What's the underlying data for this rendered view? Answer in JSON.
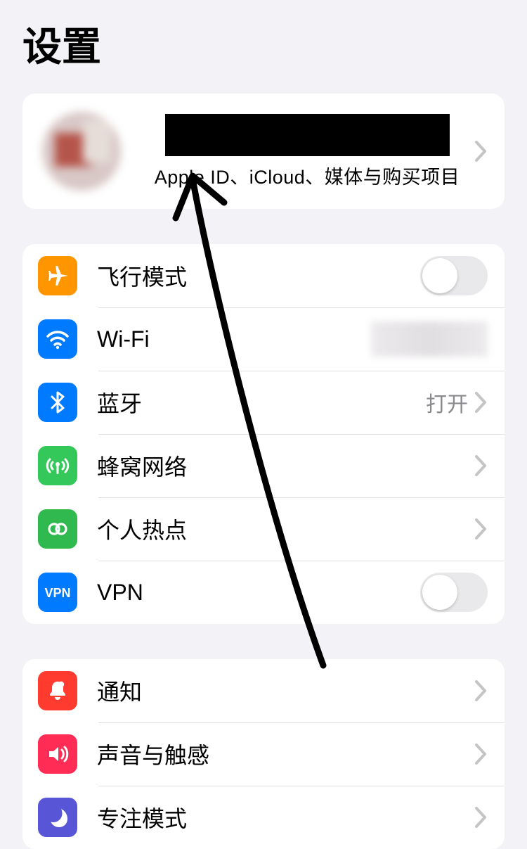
{
  "title": "设置",
  "account": {
    "subtitle": "Apple ID、iCloud、媒体与购买项目"
  },
  "groups": [
    {
      "rows": [
        {
          "key": "airplane",
          "label": "飞行模式",
          "control": "toggle",
          "on": false
        },
        {
          "key": "wifi",
          "label": "Wi-Fi",
          "control": "blur"
        },
        {
          "key": "bluetooth",
          "label": "蓝牙",
          "control": "link",
          "value": "打开"
        },
        {
          "key": "cellular",
          "label": "蜂窝网络",
          "control": "link"
        },
        {
          "key": "hotspot",
          "label": "个人热点",
          "control": "link"
        },
        {
          "key": "vpn",
          "label": "VPN",
          "control": "toggle",
          "on": false
        }
      ]
    },
    {
      "rows": [
        {
          "key": "notifications",
          "label": "通知",
          "control": "link"
        },
        {
          "key": "sounds",
          "label": "声音与触感",
          "control": "link"
        },
        {
          "key": "focus",
          "label": "专注模式",
          "control": "link"
        }
      ]
    }
  ],
  "colors": {
    "orange": "#ff9500",
    "blue": "#007aff",
    "green": "#34c759",
    "red": "#ff3b30",
    "pinkred": "#ff2d55",
    "purple": "#5856d6"
  }
}
